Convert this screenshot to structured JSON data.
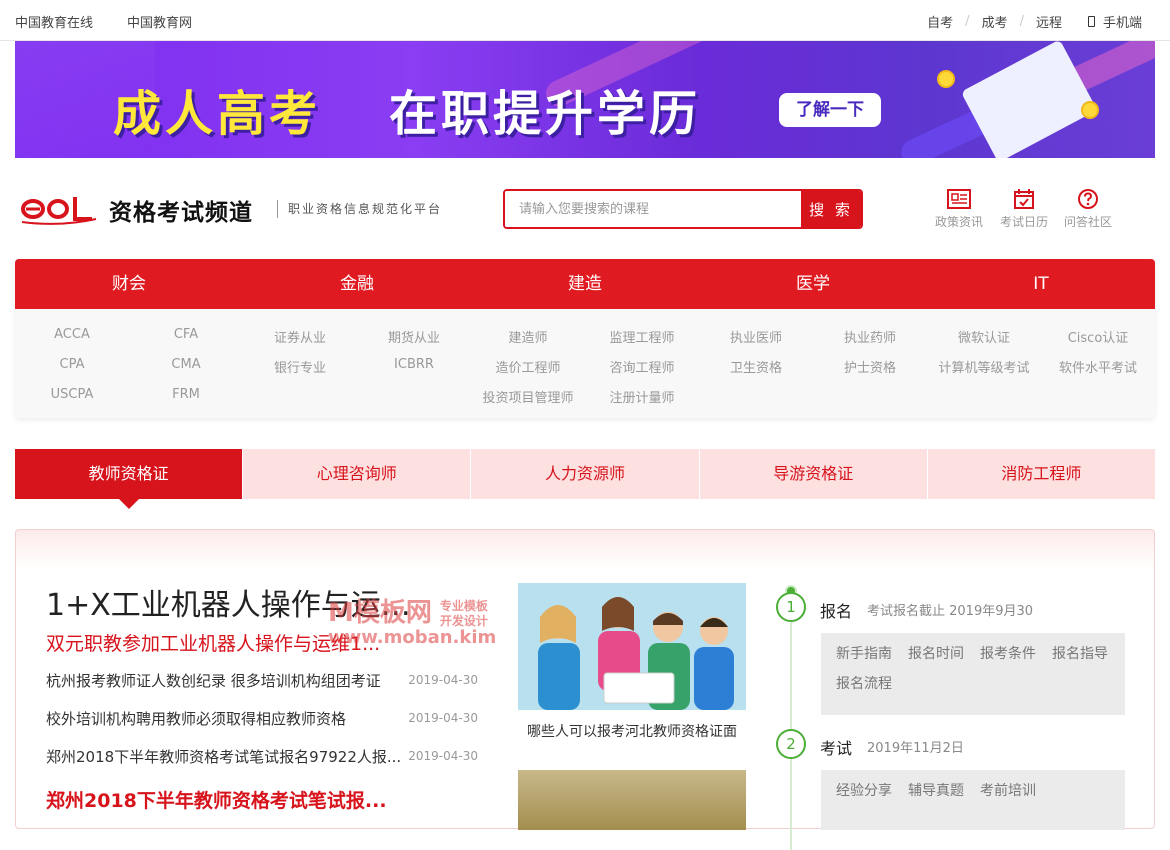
{
  "topbar": {
    "left_links": [
      "中国教育在线",
      "中国教育网"
    ],
    "right_links": [
      "自考",
      "成考",
      "远程"
    ],
    "separator": "/",
    "mobile_label": "手机端"
  },
  "banner": {
    "headline_1": "成人高考",
    "headline_2": "在职提升学历",
    "button_label": "了解一下",
    "bg_color": "#7d2cf0",
    "accent_color": "#ffe83a"
  },
  "header": {
    "logo_text": "eol",
    "title": "资格考试频道",
    "subtitle": "职业资格信息规范化平台",
    "search": {
      "placeholder": "请输入您要搜索的课程",
      "button_label": "搜 索"
    },
    "quick_links": [
      {
        "label": "政策资讯",
        "icon": "newspaper-icon"
      },
      {
        "label": "考试日历",
        "icon": "calendar-check-icon"
      },
      {
        "label": "问答社区",
        "icon": "question-icon"
      }
    ]
  },
  "nav": {
    "categories": [
      "财会",
      "金融",
      "建造",
      "医学",
      "IT"
    ],
    "items": [
      [
        "ACCA",
        "CFA",
        "CPA",
        "CMA",
        "USCPA",
        "FRM"
      ],
      [
        "证券从业",
        "期货从业",
        "银行专业",
        "ICBRR"
      ],
      [
        "建造师",
        "监理工程师",
        "造价工程师",
        "咨询工程师",
        "投资项目管理师",
        "注册计量师"
      ],
      [
        "执业医师",
        "执业药师",
        "卫生资格",
        "护士资格"
      ],
      [
        "微软认证",
        "Cisco认证",
        "计算机等级考试",
        "软件水平考试"
      ]
    ],
    "accent_color": "#e01a21"
  },
  "tabs": [
    "教师资格证",
    "心理咨询师",
    "人力资源师",
    "导游资格证",
    "消防工程师"
  ],
  "content": {
    "headline": "1+X工业机器人操作与运维...",
    "subheadline": "双元职教参加工业机器人操作与运维1...",
    "news": [
      {
        "title": "杭州报考教师证人数创纪录 很多培训机构组团考证",
        "date": "2019-04-30"
      },
      {
        "title": "校外培训机构聘用教师必须取得相应教师资格",
        "date": "2019-04-30"
      },
      {
        "title": "郑州2018下半年教师资格考试笔试报名97922人报...",
        "date": "2019-04-30"
      }
    ],
    "subheadline_2": "郑州2018下半年教师资格考试笔试报...",
    "photo_caption": "哪些人可以报考河北教师资格证面",
    "watermark": {
      "line1": "M模板网",
      "line2": "www.moban.kim",
      "tag1": "专业模板",
      "tag2": "开发设计"
    }
  },
  "timeline": [
    {
      "step": "1",
      "title": "报名",
      "desc": "考试报名截止 2019年9月30",
      "links": [
        "新手指南",
        "报名时间",
        "报考条件",
        "报名指导",
        "报名流程"
      ]
    },
    {
      "step": "2",
      "title": "考试",
      "desc": "2019年11月2日",
      "links": [
        "经验分享",
        "辅导真题",
        "考前培训"
      ]
    }
  ]
}
